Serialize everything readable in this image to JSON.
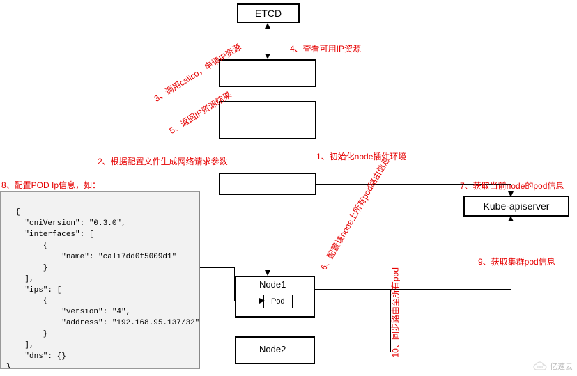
{
  "boxes": {
    "etcd": "ETCD",
    "kube_apiserver": "Kube-apiserver",
    "node1_title": "Node1",
    "pod": "Pod",
    "node2_title": "Node2"
  },
  "labels": {
    "step1": "1、初始化node插件环境",
    "step2": "2、根据配置文件生成网络请求参数",
    "step3": "3、调用calico，申请IP资源",
    "step4": "4、查看可用IP资源",
    "step5": "5、返回IP资源结果",
    "step6": "6、配置该node上所有pod路由信息",
    "step7": "7、获取当前node的pod信息",
    "step8": "8、配置POD Ip信息，如：",
    "step9": "9、获取集群pod信息",
    "step10": "10、同步路由至所有pod"
  },
  "code": "{\n    \"cniVersion\": \"0.3.0\",\n    \"interfaces\": [\n        {\n            \"name\": \"cali7dd0f5009d1\"\n        }\n    ],\n    \"ips\": [\n        {\n            \"version\": \"4\",\n            \"address\": \"192.168.95.137/32\"\n        }\n    ],\n    \"dns\": {}\n}",
  "watermark": "亿速云"
}
